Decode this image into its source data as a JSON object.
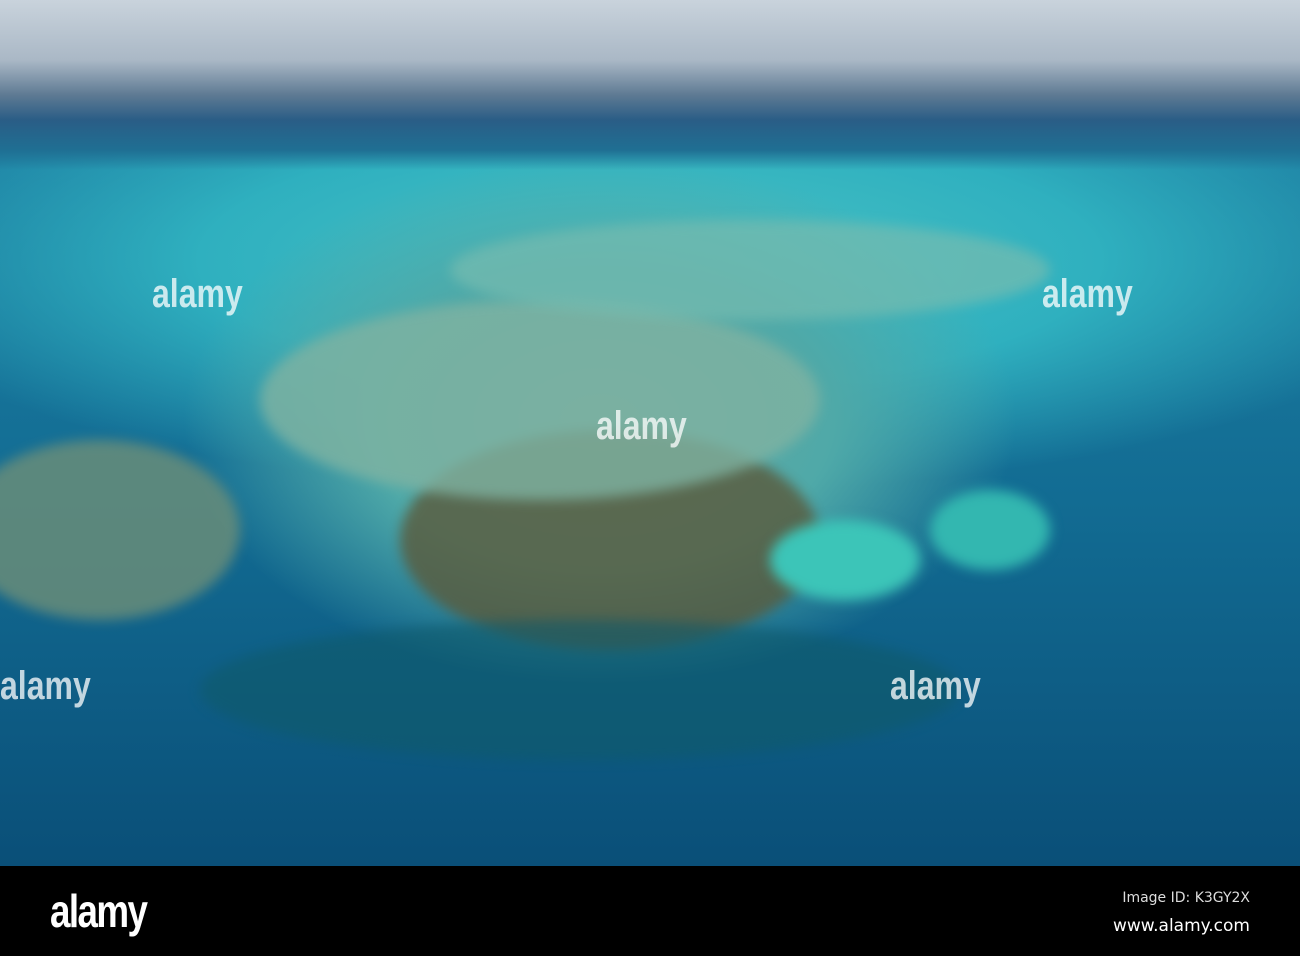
{
  "watermark": {
    "text": "alamy"
  },
  "footer": {
    "logo": "alamy",
    "image_id": "Image ID: K3GY2X",
    "website": "www.alamy.com"
  }
}
